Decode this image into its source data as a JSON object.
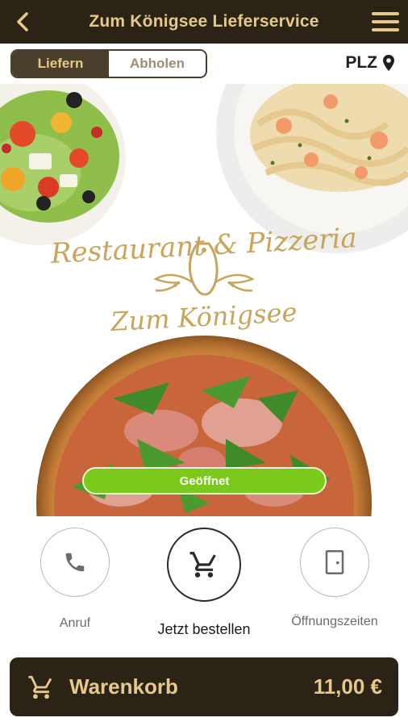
{
  "header": {
    "title": "Zum Königsee Lieferservice",
    "back_icon": "chevron-left-icon",
    "menu_icon": "hamburger-menu-icon"
  },
  "delivery_mode": {
    "options": [
      "Liefern",
      "Abholen"
    ],
    "selected": "Liefern",
    "plz_label": "PLZ",
    "plz_icon": "location-pin-icon"
  },
  "hero": {
    "logo_line1": "Restaurant & Pizzeria",
    "logo_line2": "Zum Königsee",
    "status": "Geöffnet"
  },
  "actions": [
    {
      "label": "Anruf",
      "icon": "phone-icon"
    },
    {
      "label": "Jetzt bestellen",
      "icon": "shopping-cart-icon"
    },
    {
      "label": "Öffnungszeiten",
      "icon": "door-icon"
    }
  ],
  "cart": {
    "label": "Warenkorb",
    "total": "11,00 €",
    "icon": "shopping-cart-icon"
  },
  "colors": {
    "bar_dark": "#2b2416",
    "gold": "#e6c98a",
    "logo_gold": "#c9a45a",
    "status_green": "#7bc91a"
  }
}
